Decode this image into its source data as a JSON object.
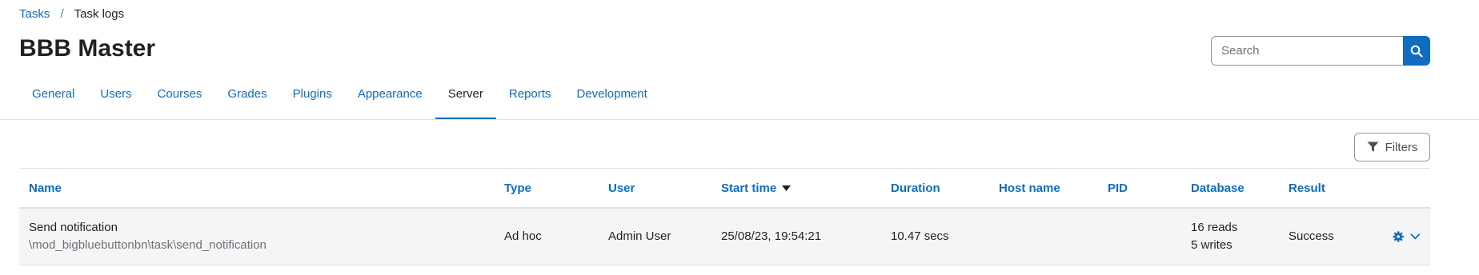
{
  "breadcrumb": {
    "items": [
      "Tasks",
      "Task logs"
    ],
    "separator": "/"
  },
  "page": {
    "title": "BBB Master"
  },
  "search": {
    "placeholder": "Search"
  },
  "tabs": [
    {
      "label": "General",
      "active": false
    },
    {
      "label": "Users",
      "active": false
    },
    {
      "label": "Courses",
      "active": false
    },
    {
      "label": "Grades",
      "active": false
    },
    {
      "label": "Plugins",
      "active": false
    },
    {
      "label": "Appearance",
      "active": false
    },
    {
      "label": "Server",
      "active": true
    },
    {
      "label": "Reports",
      "active": false
    },
    {
      "label": "Development",
      "active": false
    }
  ],
  "filters": {
    "label": "Filters",
    "icon": "filter-icon"
  },
  "table": {
    "headers": {
      "name": "Name",
      "type": "Type",
      "user": "User",
      "start_time": "Start time",
      "duration": "Duration",
      "host_name": "Host name",
      "pid": "PID",
      "database": "Database",
      "result": "Result"
    },
    "sorted_by": "start_time",
    "sort_direction": "descending",
    "rows": [
      {
        "name": "Send notification",
        "classname": "\\mod_bigbluebuttonbn\\task\\send_notification",
        "type": "Ad hoc",
        "user": "Admin User",
        "start_time": "25/08/23, 19:54:21",
        "duration": "10.47 secs",
        "host_name": "",
        "pid": "",
        "db_reads": "16 reads",
        "db_writes": "5 writes",
        "result": "Success",
        "actions": [
          "gear-icon",
          "chevron-down-icon"
        ]
      }
    ]
  },
  "colors": {
    "accent": "#0f6cbf",
    "text": "#1d2125",
    "muted": "#6a737b",
    "border": "#dee2e6",
    "row_bg": "#f5f5f5"
  }
}
